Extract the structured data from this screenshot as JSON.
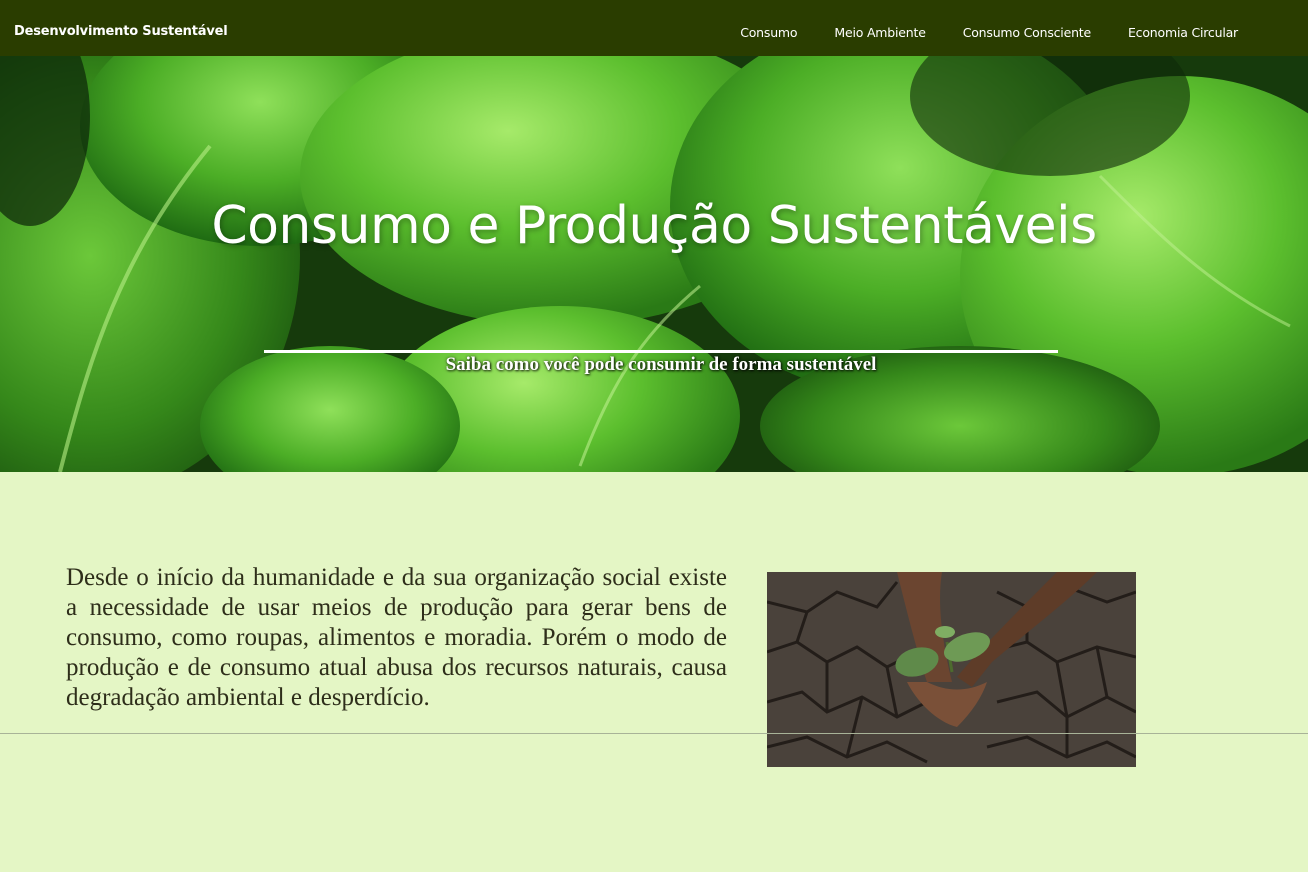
{
  "navbar": {
    "brand": "Desenvolvimento Sustentável",
    "links": [
      "Consumo",
      "Meio Ambiente",
      "Consumo Consciente",
      "Economia Circular"
    ],
    "background_color": "#2a3d00"
  },
  "hero": {
    "title": "Consumo e Produção Sustentáveis",
    "subtitle": "Saiba como você pode consumir de forma sustentável"
  },
  "main": {
    "paragraph": "Desde o início da humanidade e da sua organização social existe a necessidade de usar meios de produção para gerar bens de consumo, como roupas, alimentos e moradia. Porém o modo de produção e de consumo atual abusa dos recursos naturais, causa degradação ambiental e desperdício.",
    "background_color": "#e4f6c5"
  }
}
